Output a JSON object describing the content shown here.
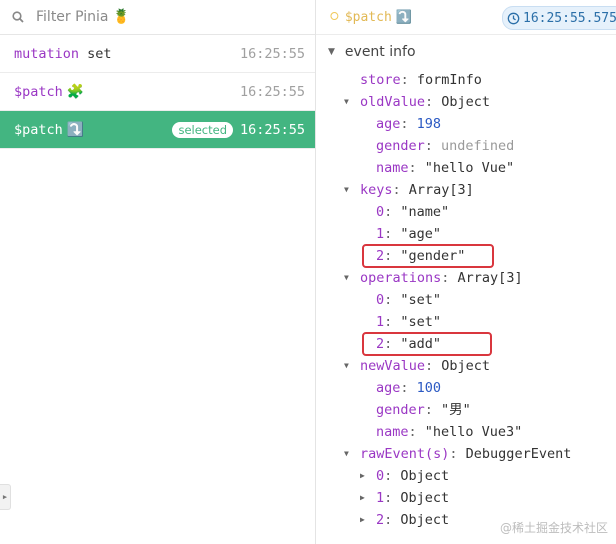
{
  "sidebar": {
    "filter_placeholder": "Filter Pinia",
    "filter_emoji": "🍍",
    "mutations": [
      {
        "kind": "mutation",
        "name": "set",
        "emoji": "",
        "time": "16:25:55",
        "selected": false
      },
      {
        "kind": "$patch",
        "name": "",
        "emoji": "🧩",
        "time": "16:25:55",
        "selected": false
      },
      {
        "kind": "$patch",
        "name": "",
        "emoji": "⤵️",
        "time": "16:25:55",
        "selected": true,
        "badge": "selected"
      }
    ]
  },
  "detail": {
    "header_title": "$patch",
    "header_emoji": "⤵️",
    "timestamp": "16:25:55.575",
    "section_title": "event info",
    "store_key": "store",
    "store_value": "formInfo",
    "oldValue": {
      "key": "oldValue",
      "type": "Object",
      "fields": [
        {
          "k": "age",
          "v": "198",
          "t": "num"
        },
        {
          "k": "gender",
          "v": "undefined",
          "t": "undef"
        },
        {
          "k": "name",
          "v": "\"hello Vue\"",
          "t": "str"
        }
      ]
    },
    "keys": {
      "key": "keys",
      "type": "Array[3]",
      "items": [
        {
          "k": "0",
          "v": "\"name\""
        },
        {
          "k": "1",
          "v": "\"age\""
        },
        {
          "k": "2",
          "v": "\"gender\""
        }
      ]
    },
    "operations": {
      "key": "operations",
      "type": "Array[3]",
      "items": [
        {
          "k": "0",
          "v": "\"set\""
        },
        {
          "k": "1",
          "v": "\"set\""
        },
        {
          "k": "2",
          "v": "\"add\""
        }
      ]
    },
    "newValue": {
      "key": "newValue",
      "type": "Object",
      "fields": [
        {
          "k": "age",
          "v": "100",
          "t": "num"
        },
        {
          "k": "gender",
          "v": "\"男\"",
          "t": "str"
        },
        {
          "k": "name",
          "v": "\"hello Vue3\"",
          "t": "str"
        }
      ]
    },
    "rawEvent": {
      "key": "rawEvent(s)",
      "type": "DebuggerEvent",
      "items": [
        {
          "k": "0",
          "v": "Object"
        },
        {
          "k": "1",
          "v": "Object"
        },
        {
          "k": "2",
          "v": "Object"
        }
      ]
    }
  },
  "watermark": "@稀土掘金技术社区",
  "colors": {
    "accent": "#43b581",
    "key": "#9a37c4",
    "number": "#2b59c3",
    "highlight": "#d9363e"
  }
}
